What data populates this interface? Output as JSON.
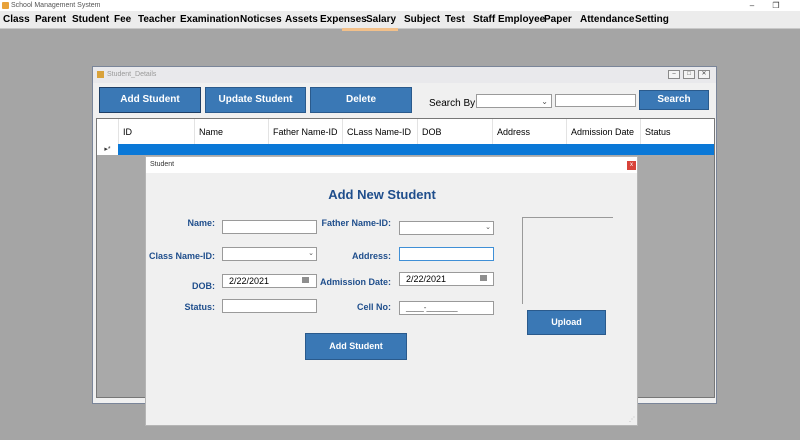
{
  "app": {
    "title": "School Management System"
  },
  "menu": [
    "Class",
    "Parent",
    "Student",
    "Fee",
    "Teacher",
    "Examination",
    "Noticses",
    "Assets",
    "Expenses",
    "Salary",
    "Subject",
    "Test",
    "Staff Employee",
    "Paper",
    "Attendance",
    "Setting"
  ],
  "student_details": {
    "title": "Student_Details",
    "add_label": "Add Student",
    "update_label": "Update Student",
    "delete_label": "Delete",
    "search_by_label": "Search By:",
    "search_label": "Search",
    "columns": [
      "ID",
      "Name",
      "Father Name-ID",
      "CLass Name-ID",
      "DOB",
      "Address",
      "Admission Date",
      "Status"
    ],
    "row_header": "▸*"
  },
  "student_dialog": {
    "title": "Student",
    "close": "x",
    "heading": "Add New Student",
    "name_label": "Name:",
    "father_label": "Father Name-ID:",
    "class_label": "Class Name-ID:",
    "address_label": "Address:",
    "dob_label": "DOB:",
    "dob_value": "2/22/2021",
    "admission_label": "Admission Date:",
    "admission_value": "2/22/2021",
    "status_label": "Status:",
    "cell_label": "Cell No:",
    "cell_mask": "____-_______",
    "upload_label": "Upload",
    "submit_label": "Add Student"
  }
}
